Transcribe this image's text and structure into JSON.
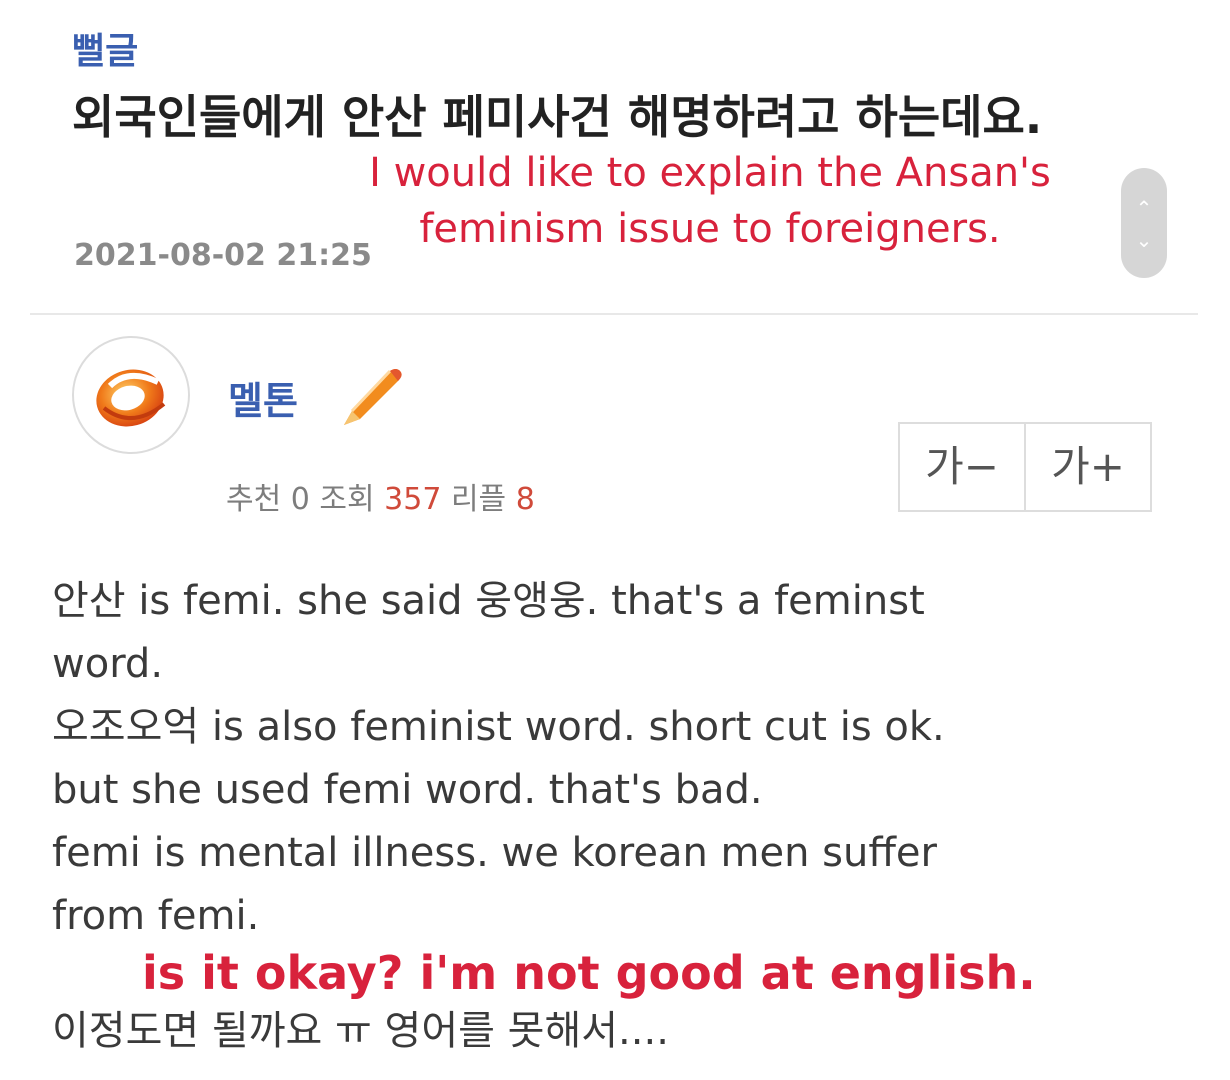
{
  "post": {
    "board": "뻘글",
    "title": "외국인들에게 안산 페미사건 해명하려고 하는데요.",
    "date": "2021-08-02 21:25"
  },
  "overlay": {
    "top_line1": "I would like to explain the Ansan's",
    "top_line2": "feminism issue to foreigners.",
    "bottom": "is it okay? i'm not good at english."
  },
  "author": {
    "name": "멜톤",
    "avatar_icon": "author-avatar-icon",
    "badge_icon": "pencil-badge-icon"
  },
  "stats": {
    "recommend_label": "추천",
    "recommend_value": "0",
    "views_label": "조회",
    "views_value": "357",
    "replies_label": "리플",
    "replies_value": "8"
  },
  "font_controls": {
    "decrease_label": "가−",
    "increase_label": "가+"
  },
  "content": {
    "lines": [
      "안산 is femi. she said 웅앵웅. that's a feminst",
      "word.",
      "오조오억 is also feminist word. short cut is ok.",
      "but she used femi word. that's bad.",
      "femi is mental illness. we korean men suffer",
      "from femi."
    ],
    "last_line": "이정도면 될까요 ㅠ 영어를 못해서...."
  },
  "colors": {
    "link_blue": "#3a5fb0",
    "overlay_red": "#d8223c",
    "highlight_red": "#d04a3a"
  }
}
